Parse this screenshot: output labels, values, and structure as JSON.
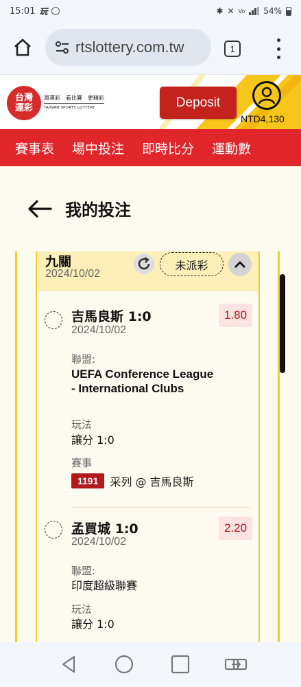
{
  "status_bar": {
    "time": "15:01",
    "battery": "54%"
  },
  "browser": {
    "url": "rtslottery.com.tw",
    "tab_count": "1"
  },
  "header": {
    "logo_mark": "台灣運彩",
    "logo_tagline": "買運彩　看比賽　更精彩",
    "logo_sub": "TAIWAN SPORTS LOTTERY",
    "deposit_label": "Deposit",
    "balance": "NTD4,130"
  },
  "nav": {
    "items": [
      "賽事表",
      "場中投注",
      "即時比分",
      "運動數"
    ]
  },
  "page": {
    "title": "我的投注"
  },
  "bet": {
    "type": "九關",
    "date": "2024/10/02",
    "status": "未派彩",
    "legs": [
      {
        "team": "吉馬良斯 1:0",
        "date": "2024/10/02",
        "odds": "1.80",
        "league_label": "聯盟:",
        "league": "UEFA Conference League - International Clubs",
        "play_label": "玩法",
        "play": "讓分 1:0",
        "event_label": "賽事",
        "event_code": "1191",
        "event_name": "采列 @ 吉馬良斯"
      },
      {
        "team": "孟買城 1:0",
        "date": "2024/10/02",
        "odds": "2.20",
        "league_label": "聯盟:",
        "league": "印度超級聯賽",
        "play_label": "玩法",
        "play": "讓分 1:0"
      }
    ]
  },
  "colors": {
    "brand_red": "#e0262a",
    "deposit_red": "#c4221c",
    "accent_yellow": "#f2cd2d",
    "odds_red": "#b2191c"
  }
}
